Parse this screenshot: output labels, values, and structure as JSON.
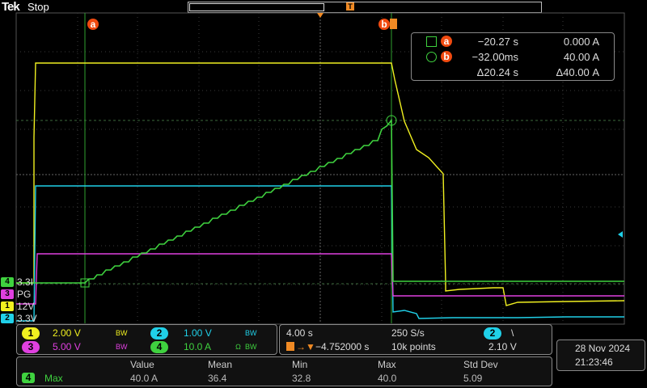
{
  "header": {
    "brand": "Tek",
    "status": "Stop",
    "trigger_marker": "T"
  },
  "cursors": {
    "a_label": "a",
    "b_label": "b",
    "readout": {
      "a_time": "−20.27 s",
      "a_value": "0.000 A",
      "b_time": "−32.00ms",
      "b_value": "40.00 A",
      "delta_time": "Δ20.24 s",
      "delta_value": "Δ40.00 A"
    }
  },
  "channel_labels": [
    {
      "num": "4",
      "text": "3.3I",
      "color": "#3fd23f"
    },
    {
      "num": "3",
      "text": "PG",
      "color": "#e040e0"
    },
    {
      "num": "1",
      "text": "12V",
      "color": "#f0f020"
    },
    {
      "num": "2",
      "text": "3.3V",
      "color": "#20d0e8"
    }
  ],
  "vertical": {
    "ch1": {
      "num": "1",
      "scale": "2.00 V",
      "color": "#f0f020"
    },
    "ch2": {
      "num": "2",
      "scale": "1.00 V",
      "color": "#20d0e8"
    },
    "ch3": {
      "num": "3",
      "scale": "5.00 V",
      "color": "#e040e0"
    },
    "ch4": {
      "num": "4",
      "scale": "10.0 A",
      "color": "#3fd23f"
    },
    "bw_mark": "BW"
  },
  "timebase": {
    "scale": "4.00 s",
    "sample_rate": "250 S/s",
    "position": "−4.752000 s",
    "record_length": "10k points",
    "trigger_source": "2",
    "trigger_slope": "\\",
    "trigger_level": "2.10 V"
  },
  "datetime": {
    "date": "28 Nov 2024",
    "time": "21:23:46"
  },
  "measurement": {
    "source": "4",
    "name": "Max",
    "headers": [
      "Value",
      "Mean",
      "Min",
      "Max",
      "Std Dev"
    ],
    "values": [
      "40.0 A",
      "36.4",
      "32.8",
      "40.0",
      "5.09"
    ]
  }
}
